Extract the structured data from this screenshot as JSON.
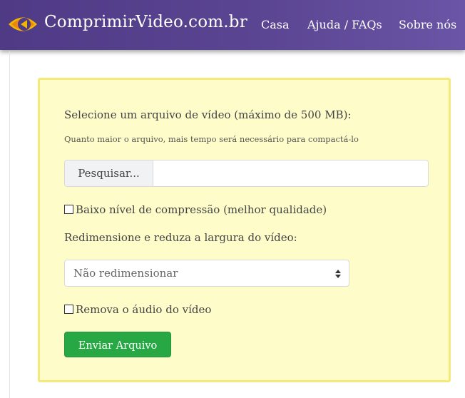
{
  "header": {
    "brand": "ComprimirVideo.com.br",
    "nav": {
      "home": "Casa",
      "help": "Ajuda / FAQs",
      "about": "Sobre nós"
    },
    "logo_icon": "play-eye-logo-icon"
  },
  "form": {
    "title": "Selecione um arquivo de vídeo (máximo de 500 MB):",
    "hint": "Quanto maior o arquivo, mais tempo será necessário para compactá-lo",
    "file_button": "Pesquisar...",
    "file_name": "",
    "low_compression": {
      "label": "Baixo nível de compressão (melhor qualidade)",
      "checked": false
    },
    "resize_label": "Redimensione e reduza a largura do vídeo:",
    "resize_select": {
      "selected": "Não redimensionar"
    },
    "remove_audio": {
      "label": "Remova o áudio do vídeo",
      "checked": false
    },
    "submit": "Enviar Arquivo"
  },
  "colors": {
    "navbar": "#5a4592",
    "panel_bg": "#fefcc8",
    "panel_border": "#f4ea7a",
    "submit": "#28a745"
  }
}
